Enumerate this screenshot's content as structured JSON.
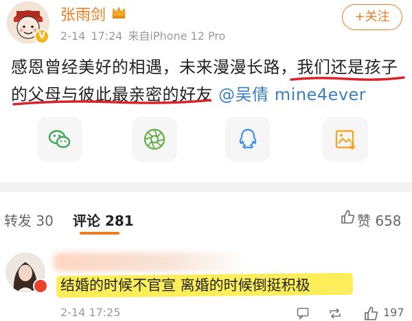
{
  "post": {
    "author": "张雨剑",
    "date": "2-14",
    "time": "17:24",
    "source": "来自iPhone 12 Pro",
    "follow_label": "+关注",
    "text_line1_part1": "感恩曾经美好的相遇，未来漫漫长路，",
    "text_line1_part2": "我们还是孩子",
    "text_line2_part1": "的父母与彼此最亲密的好友",
    "mention": "@吴倩",
    "mention_suffix": " mine4ever"
  },
  "share_icons": [
    "wechat-icon",
    "moments-icon",
    "qq-icon",
    "save-image-icon"
  ],
  "tabs": {
    "repost_label": "转发",
    "repost_count": "30",
    "comment_label": "评论",
    "comment_count": "281",
    "like_label": "赞",
    "like_count": "658"
  },
  "comment": {
    "text": "结婚的时候不官宣 离婚的时候倒挺积极",
    "date": "2-14",
    "time": "17:25",
    "like_count": "197"
  },
  "colors": {
    "accent": "#f07b1f",
    "mention": "#3a7fbf",
    "underline_red": "#d8232a",
    "highlight_yellow": "#fcee5b"
  }
}
